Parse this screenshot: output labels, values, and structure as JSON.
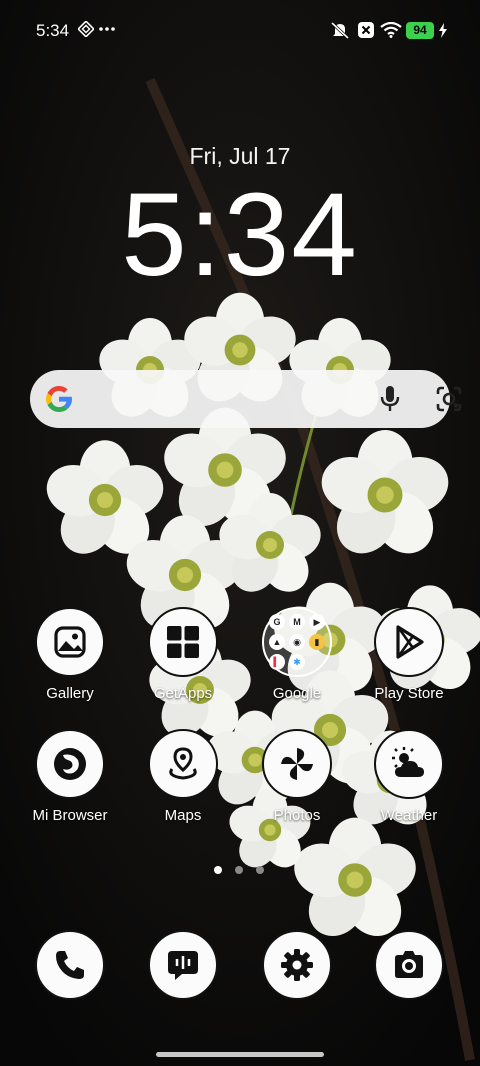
{
  "status_bar": {
    "time": "5:34",
    "left_icons": [
      "app-notification-icon",
      "more-notifications-icon"
    ],
    "right_icons": [
      "silent-mode-icon",
      "sim-off-icon",
      "wifi-icon",
      "charging-icon"
    ],
    "battery": "94",
    "battery_color": "#3bd14c"
  },
  "lockscreen": {
    "date": "Fri, Jul 17",
    "clock": "5:34"
  },
  "search_bar": {
    "icons": [
      "google-logo",
      "mic-icon",
      "lens-icon"
    ]
  },
  "apps": [
    {
      "label": "Gallery",
      "icon": "gallery-icon"
    },
    {
      "label": "GetApps",
      "icon": "getapps-icon"
    },
    {
      "label": "Google",
      "icon": "google-folder-icon"
    },
    {
      "label": "Play Store",
      "icon": "play-store-icon"
    },
    {
      "label": "Mi Browser",
      "icon": "mi-browser-icon"
    },
    {
      "label": "Maps",
      "icon": "maps-icon"
    },
    {
      "label": "Photos",
      "icon": "photos-icon"
    },
    {
      "label": "Weather",
      "icon": "weather-icon"
    }
  ],
  "google_folder_minis": [
    "G",
    "M",
    "▶",
    "▲",
    "◉",
    "▮",
    "▍",
    "✱",
    ""
  ],
  "page_indicator": {
    "count": 3,
    "active": 0
  },
  "dock": [
    {
      "icon": "phone-icon"
    },
    {
      "icon": "messages-icon"
    },
    {
      "icon": "settings-icon"
    },
    {
      "icon": "camera-icon"
    }
  ]
}
